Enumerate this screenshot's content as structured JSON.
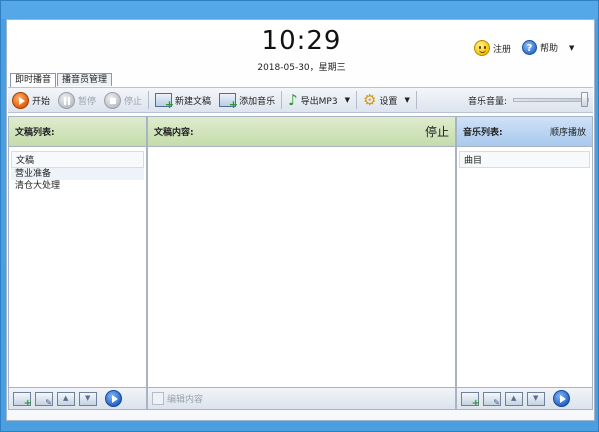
{
  "header": {
    "time": "10:29",
    "date": "2018-05-30，星期三",
    "register_label": "注册",
    "help_label": "帮助"
  },
  "tabs": [
    {
      "label": "即时播音"
    },
    {
      "label": "播音员管理"
    }
  ],
  "toolbar": {
    "start": "开始",
    "pause": "暂停",
    "stop": "停止",
    "new_doc": "新建文稿",
    "add_music": "添加音乐",
    "export_mp3": "导出MP3",
    "settings": "设置",
    "volume_label": "音乐音量:",
    "volume_level": 1.0
  },
  "doc_list": {
    "title": "文稿列表:",
    "column": "文稿",
    "items": [
      {
        "label": "营业准备"
      },
      {
        "label": "清仓大处理"
      }
    ]
  },
  "doc_content": {
    "title": "文稿内容:",
    "status": "停止",
    "edit_label": "编辑内容"
  },
  "music_list": {
    "title": "音乐列表:",
    "mode": "顺序播放",
    "column": "曲目"
  },
  "colors": {
    "title_bar": "#55a8e8",
    "left_header": "#c4dcaa",
    "right_header": "#a9c9ee"
  }
}
